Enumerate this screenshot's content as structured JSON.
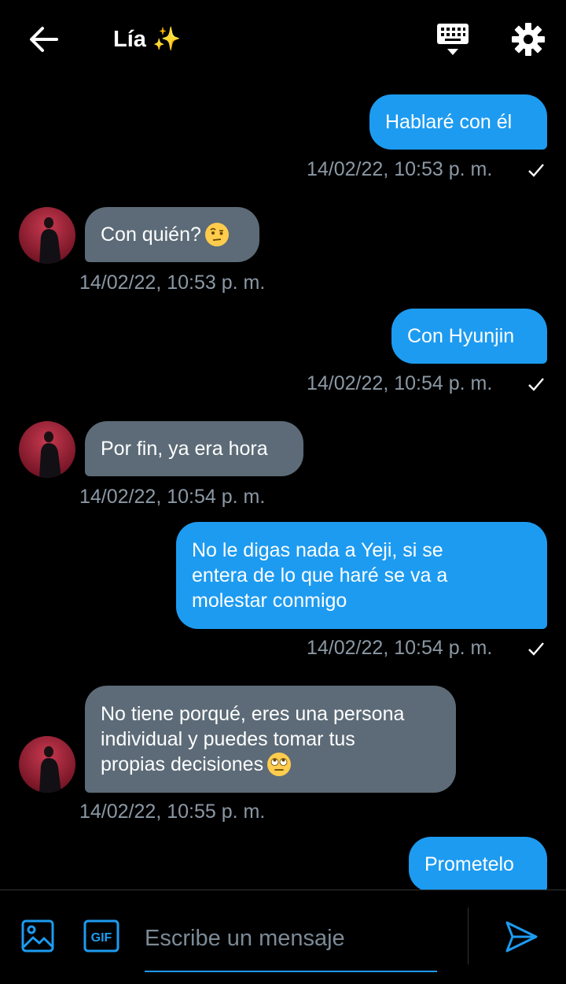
{
  "header": {
    "title": "Lía ✨"
  },
  "messages": [
    {
      "direction": "out",
      "text": "Hablaré con él",
      "timestamp": "14/02/22, 10:53 p. m.",
      "read": true
    },
    {
      "direction": "in",
      "text": "Con quién?",
      "emoji": "face-with-raised-eyebrow",
      "timestamp": "14/02/22, 10:53 p. m."
    },
    {
      "direction": "out",
      "text": "Con Hyunjin",
      "timestamp": "14/02/22, 10:54 p. m.",
      "read": true
    },
    {
      "direction": "in",
      "text": "Por fin, ya era hora",
      "timestamp": "14/02/22, 10:54 p. m."
    },
    {
      "direction": "out",
      "lines": [
        "No le digas nada a Yeji, si se",
        "entera de lo que haré se va a",
        "molestar conmigo"
      ],
      "timestamp": "14/02/22, 10:54 p. m.",
      "read": true
    },
    {
      "direction": "in",
      "lines": [
        "No tiene porqué, eres una persona",
        "individual y puedes tomar tus",
        "propias decisiones"
      ],
      "emoji": "face-with-rolling-eyes",
      "timestamp": "14/02/22, 10:55 p. m."
    },
    {
      "direction": "out",
      "text": "Prometelo"
    }
  ],
  "composer": {
    "placeholder": "Escribe un mensaje",
    "gif_label": "GIF"
  },
  "colors": {
    "accent": "#1d9bf0",
    "incoming_bubble": "#5c6b77",
    "timestamp": "#8b98a5",
    "background": "#000000"
  },
  "icons": [
    "arrow-left-icon",
    "keyboard-icon",
    "gear-icon",
    "image-icon",
    "gif-icon",
    "send-icon",
    "check-icon"
  ]
}
